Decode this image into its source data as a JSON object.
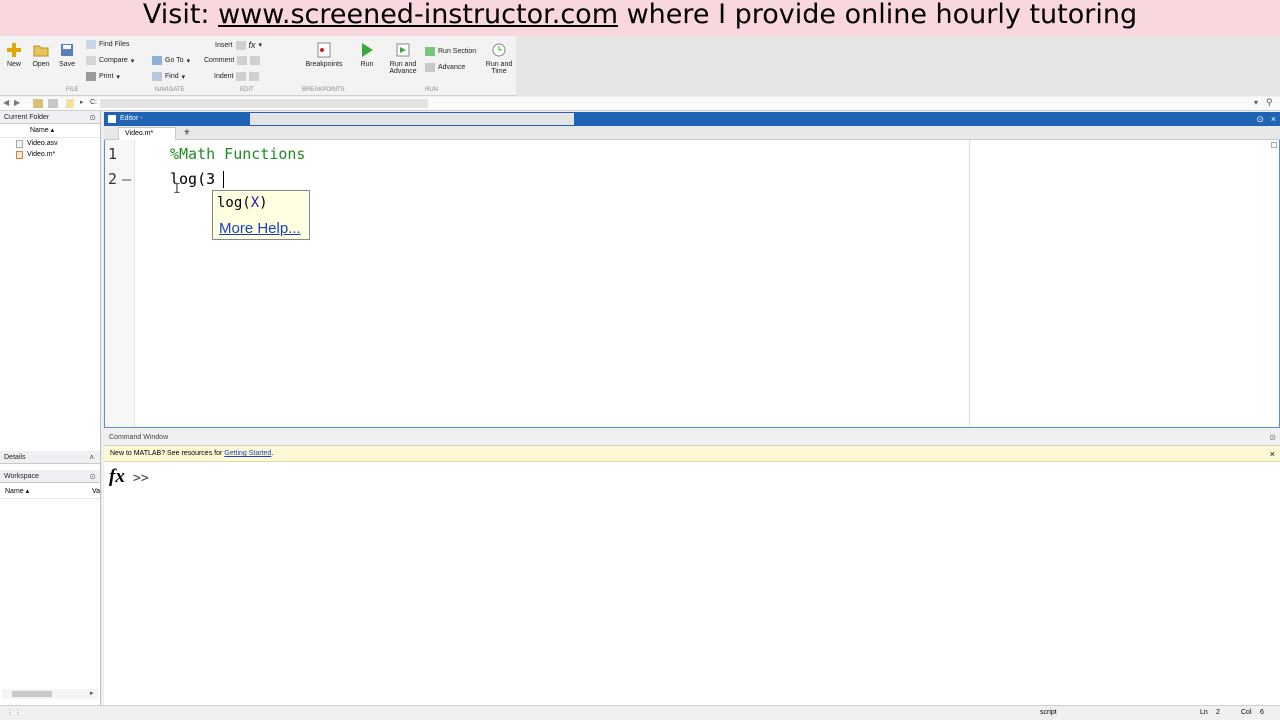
{
  "banner": {
    "prefix": "Visit: ",
    "link": "www.screened-instructor.com",
    "suffix": " where I provide online hourly tutoring"
  },
  "toolstrip": {
    "new": "New",
    "open": "Open",
    "save": "Save",
    "find_files": "Find Files",
    "compare": "Compare",
    "print": "Print",
    "go_to": "Go To",
    "find": "Find",
    "insert": "Insert",
    "fx": "fx",
    "comment": "Comment",
    "indent": "Indent",
    "breakpoints": "Breakpoints",
    "run": "Run",
    "run_and_advance": "Run and Advance",
    "run_section": "Run Section",
    "advance": "Advance",
    "run_and_time": "Run and Time",
    "sections": {
      "file": "FILE",
      "navigate": "NAVIGATE",
      "edit": "EDIT",
      "breakpoints": "BREAKPOINTS",
      "run": "RUN"
    }
  },
  "addressbar": {
    "path": "C:"
  },
  "current_folder": {
    "title": "Current Folder",
    "column": "Name ▴",
    "files": [
      {
        "name": "Video.asv"
      },
      {
        "name": "Video.m*"
      }
    ]
  },
  "details": {
    "title": "Details"
  },
  "workspace": {
    "title": "Workspace",
    "column_name": "Name ▴",
    "column_value": "Va"
  },
  "editor": {
    "title": "Editor -",
    "tab": "Video.m*",
    "tab_add": "+",
    "lines": [
      {
        "num": "1",
        "marker": "",
        "text": "%Math Functions"
      },
      {
        "num": "2",
        "marker": "—",
        "text": "log(3"
      }
    ]
  },
  "tooltip": {
    "sig_name": "log",
    "sig_open": "(",
    "sig_arg": "X",
    "sig_close": ")",
    "help": "More Help..."
  },
  "command_window": {
    "title": "Command Window",
    "notice": "New to MATLAB? See resources for ",
    "notice_link": "Getting Started",
    "notice_end": ".",
    "prompt": ">>",
    "fx": "fx"
  },
  "status": {
    "mode": "script",
    "ln_label": "Ln",
    "ln": "2",
    "col_label": "Col",
    "col": "6"
  },
  "colors": {
    "comment": "#228b22",
    "editor_header": "#1e63b4",
    "link": "#1a3fc0",
    "banner": "#f8d7de"
  }
}
